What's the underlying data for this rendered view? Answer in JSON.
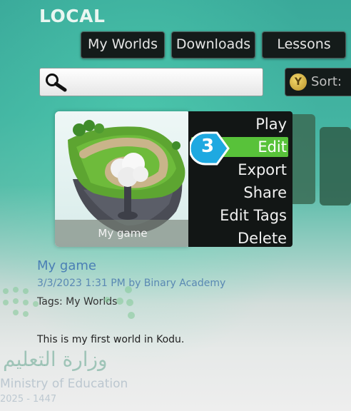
{
  "header": {
    "title": "LOCAL"
  },
  "tabs": [
    {
      "label": "My Worlds"
    },
    {
      "label": "Downloads"
    },
    {
      "label": "Lessons"
    }
  ],
  "search": {
    "value": "",
    "placeholder": ""
  },
  "sort": {
    "button_glyph": "Y",
    "label": "Sort:"
  },
  "world": {
    "thumbnail_label": "My game",
    "name": "My game",
    "meta": "3/3/2023 1:31 PM by Binary Academy",
    "tags": "Tags: My Worlds",
    "description": "This is my first world in Kodu."
  },
  "context_menu": {
    "items": [
      "Play",
      "Edit",
      "Export",
      "Share",
      "Edit Tags",
      "Delete"
    ],
    "selected": "Edit"
  },
  "step_badge": "3",
  "watermark": {
    "arabic": "وزارة التعليم",
    "english": "Ministry of Education",
    "year": "2025 - 1447"
  },
  "colors": {
    "menu_selected": "#58c23a",
    "badge": "#1ea9e1",
    "text_link": "#4a7fb5"
  }
}
